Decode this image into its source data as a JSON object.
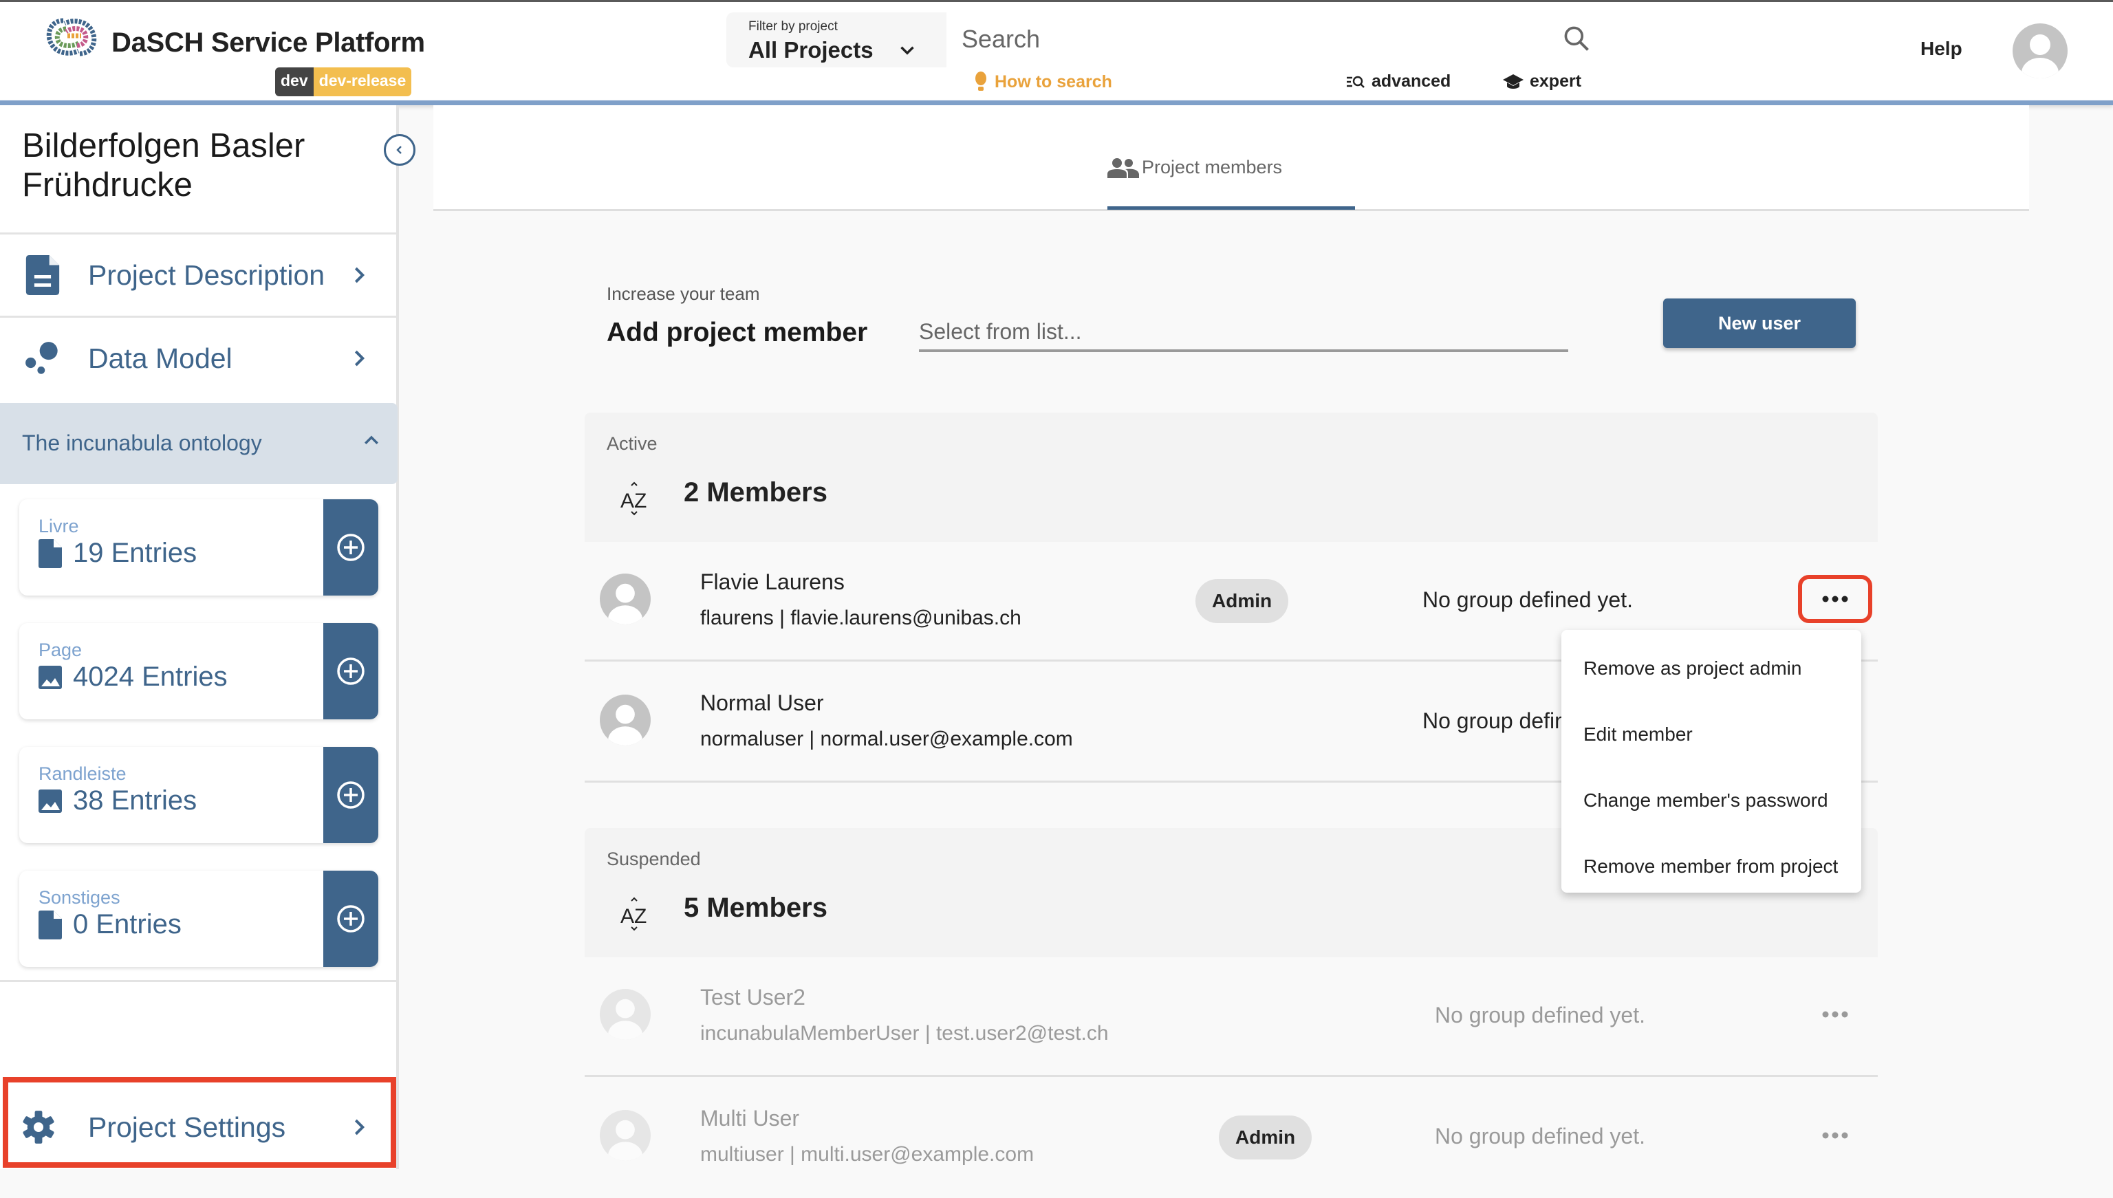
{
  "header": {
    "app_title": "DaSCH Service Platform",
    "env_badge": {
      "env": "dev",
      "release": "dev-release"
    },
    "filter": {
      "label": "Filter by project",
      "value": "All Projects"
    },
    "search": {
      "placeholder": "Search",
      "value": ""
    },
    "how_to_search": "How to search",
    "advanced": "advanced",
    "expert": "expert",
    "help": "Help",
    "colors": {
      "accent": "#3f658b",
      "bar": "#7fa0c9",
      "badge_release": "#f3be4f",
      "howto": "#e9a23b"
    }
  },
  "sidebar": {
    "project_title": "Bilderfolgen Basler Frühdrucke",
    "nav": [
      {
        "label": "Project Description",
        "icon": "description-icon"
      },
      {
        "label": "Data Model",
        "icon": "bubbles-icon"
      }
    ],
    "ontology": {
      "label": "The incunabula ontology",
      "expanded": true,
      "resources": [
        {
          "name": "Livre",
          "count": "19 Entries",
          "icon": "document-icon"
        },
        {
          "name": "Page",
          "count": "4024 Entries",
          "icon": "image-icon"
        },
        {
          "name": "Randleiste",
          "count": "38 Entries",
          "icon": "image-icon"
        },
        {
          "name": "Sonstiges",
          "count": "0 Entries",
          "icon": "document-icon"
        }
      ]
    },
    "settings": {
      "label": "Project Settings",
      "highlight_color": "#e8412a"
    }
  },
  "main": {
    "tab": {
      "label": "Project members",
      "active": true
    },
    "add_member": {
      "subtitle": "Increase your team",
      "title": "Add project member",
      "select_placeholder": "Select from list...",
      "new_user_label": "New user"
    },
    "active": {
      "label": "Active",
      "count": "2 Members",
      "members": [
        {
          "name": "Flavie Laurens",
          "meta": "flaurens | flavie.laurens@unibas.ch",
          "role": "Admin",
          "group": "No group defined yet."
        },
        {
          "name": "Normal User",
          "meta": "normaluser | normal.user@example.com",
          "role": "",
          "group": "No group defined yet."
        }
      ]
    },
    "suspended": {
      "label": "Suspended",
      "count": "5 Members",
      "members": [
        {
          "name": "Test User2",
          "meta": "incunabulaMemberUser | test.user2@test.ch",
          "role": "",
          "group": "No group defined yet."
        },
        {
          "name": "Multi User",
          "meta": "multiuser | multi.user@example.com",
          "role": "Admin",
          "group": "No group defined yet."
        }
      ]
    },
    "context_menu": {
      "items": [
        "Remove as project admin",
        "Edit member",
        "Change member's password",
        "Remove member from project"
      ]
    }
  }
}
